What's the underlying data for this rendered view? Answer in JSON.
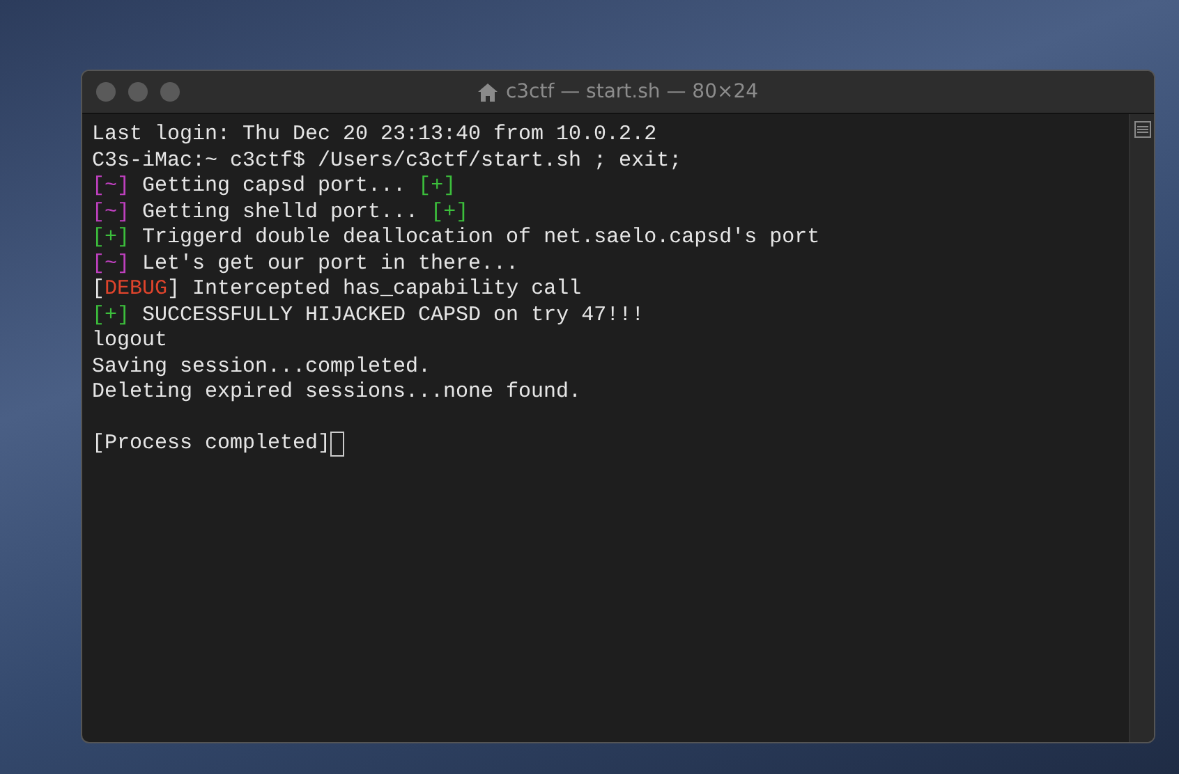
{
  "window": {
    "title": "c3ctf — start.sh — 80×24"
  },
  "lines": [
    {
      "kind": "text",
      "segments": [
        {
          "kind": "plain",
          "text": "Last login: Thu Dec 20 23:13:40 from 10.0.2.2"
        }
      ]
    },
    {
      "kind": "text",
      "segments": [
        {
          "kind": "plain",
          "text": "C3s-iMac:~ c3ctf$ /Users/c3ctf/start.sh ; exit;"
        }
      ]
    },
    {
      "kind": "text",
      "segments": [
        {
          "kind": "magenta",
          "text": "[~]"
        },
        {
          "kind": "plain",
          "text": " Getting capsd port... "
        },
        {
          "kind": "green",
          "text": "[+]"
        }
      ]
    },
    {
      "kind": "text",
      "segments": [
        {
          "kind": "magenta",
          "text": "[~]"
        },
        {
          "kind": "plain",
          "text": " Getting shelld port... "
        },
        {
          "kind": "green",
          "text": "[+]"
        }
      ]
    },
    {
      "kind": "text",
      "segments": [
        {
          "kind": "green",
          "text": "[+]"
        },
        {
          "kind": "plain",
          "text": " Triggerd double deallocation of net.saelo.capsd's port"
        }
      ]
    },
    {
      "kind": "text",
      "segments": [
        {
          "kind": "magenta",
          "text": "[~]"
        },
        {
          "kind": "plain",
          "text": " Let's get our port in there..."
        }
      ]
    },
    {
      "kind": "text",
      "segments": [
        {
          "kind": "plain",
          "text": "["
        },
        {
          "kind": "red",
          "text": "DEBUG"
        },
        {
          "kind": "plain",
          "text": "] Intercepted has_capability call"
        }
      ]
    },
    {
      "kind": "text",
      "segments": [
        {
          "kind": "green",
          "text": "[+]"
        },
        {
          "kind": "plain",
          "text": " SUCCESSFULLY HIJACKED CAPSD on try 47!!!"
        }
      ]
    },
    {
      "kind": "text",
      "segments": [
        {
          "kind": "plain",
          "text": "logout"
        }
      ]
    },
    {
      "kind": "text",
      "segments": [
        {
          "kind": "plain",
          "text": "Saving session...completed."
        }
      ]
    },
    {
      "kind": "text",
      "segments": [
        {
          "kind": "plain",
          "text": "Deleting expired sessions...none found."
        }
      ]
    },
    {
      "kind": "blank"
    },
    {
      "kind": "prompt",
      "segments": [
        {
          "kind": "plain",
          "text": "[Process completed]"
        }
      ]
    }
  ]
}
